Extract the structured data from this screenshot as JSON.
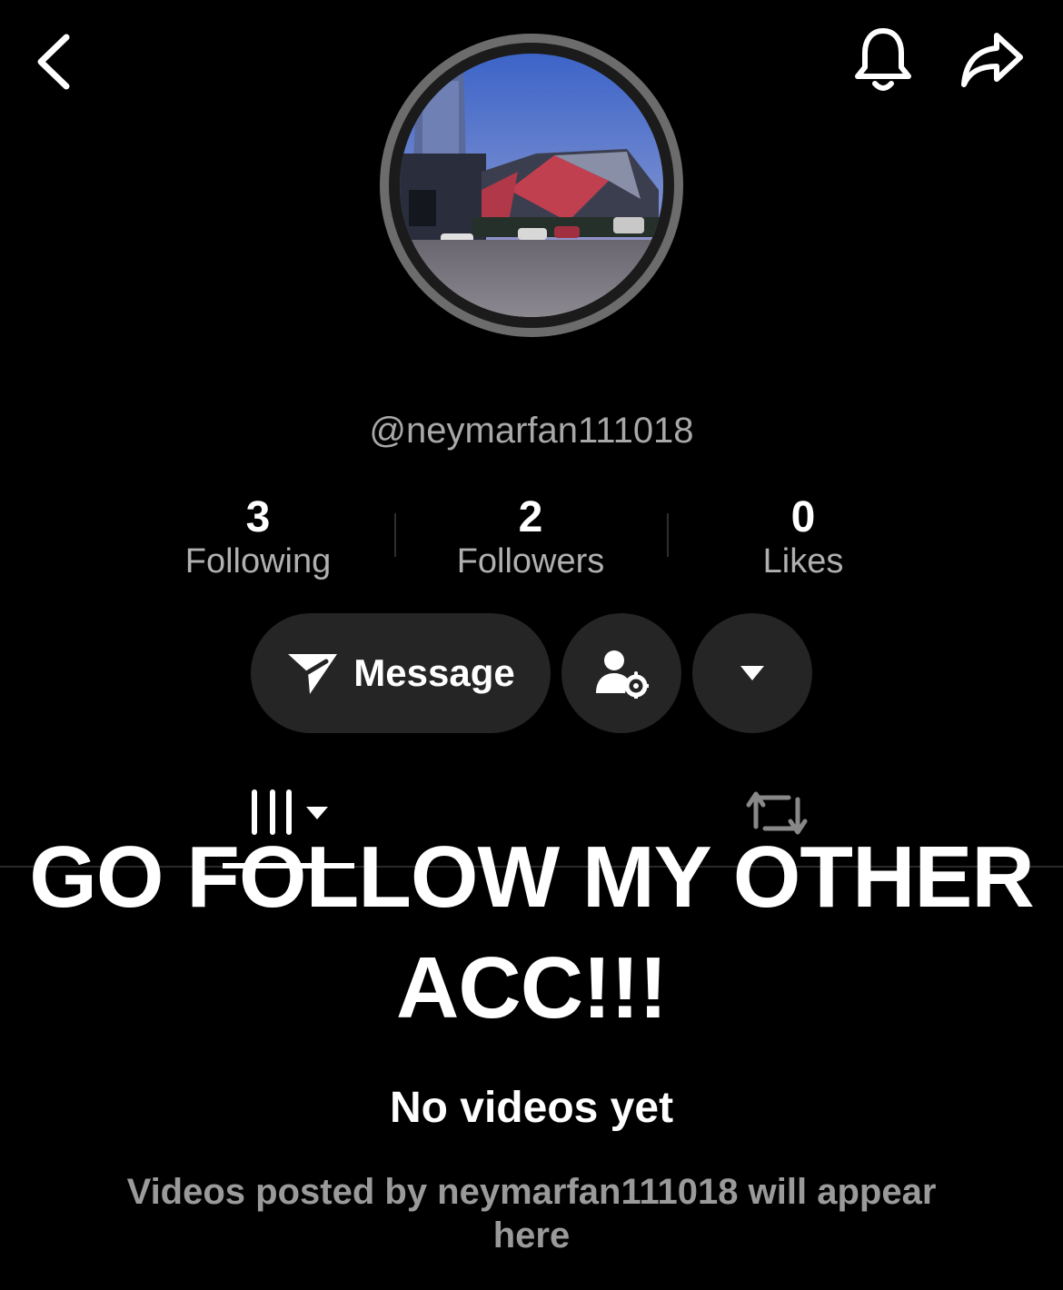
{
  "header": {
    "back_icon": "chevron-left-icon",
    "notification_icon": "bell-icon",
    "share_icon": "share-arrow-icon"
  },
  "profile": {
    "username": "@neymarfan111018",
    "avatar": "stadium-photo-avatar"
  },
  "stats": [
    {
      "value": "3",
      "label": "Following"
    },
    {
      "value": "2",
      "label": "Followers"
    },
    {
      "value": "0",
      "label": "Likes"
    }
  ],
  "actions": {
    "message_label": "Message",
    "message_icon": "send-icon",
    "friend_settings_icon": "user-gear-icon",
    "more_icon": "caret-down-icon"
  },
  "tabs": {
    "videos_icon": "grid-bars-icon",
    "reposts_icon": "repost-icon"
  },
  "overlay": {
    "caption": "GO FOLLOW MY OTHER ACC!!!"
  },
  "empty_state": {
    "title": "No videos yet",
    "description": "Videos posted by neymarfan111018 will appear here"
  },
  "colors": {
    "background": "#000000",
    "button_bg": "#252525",
    "secondary_text": "#a8a8a8"
  }
}
